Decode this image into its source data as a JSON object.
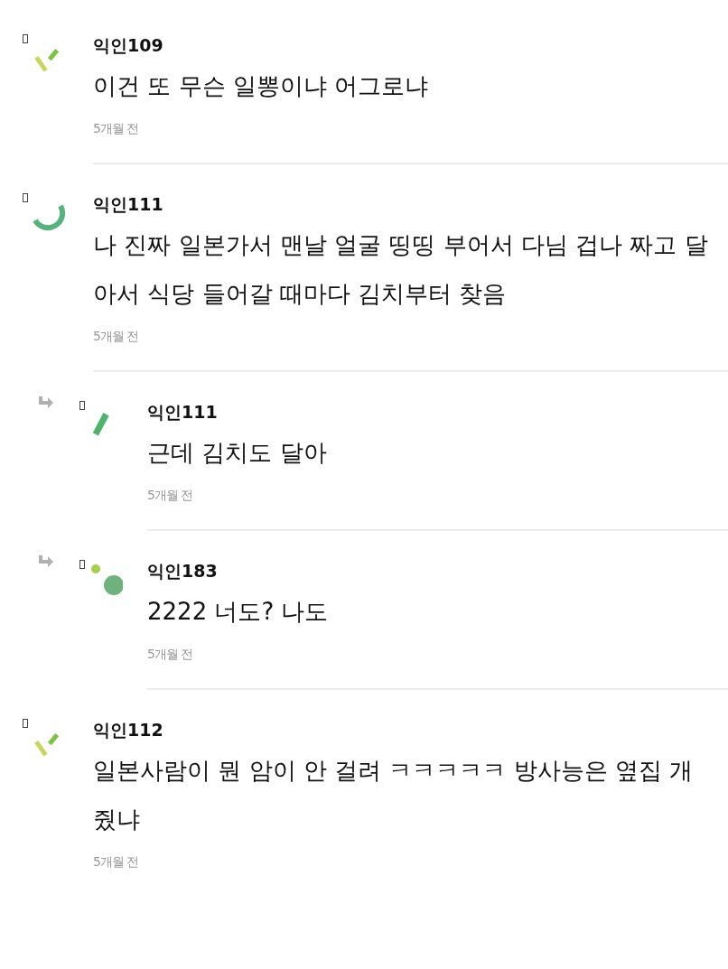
{
  "comments": [
    {
      "author": "익인109",
      "kind": "dashes",
      "text": "이건 또 무슨 일뽕이냐 어그로냐",
      "time": "5개월 전"
    },
    {
      "author": "익인111",
      "kind": "arc",
      "text": "나 진짜 일본가서 맨날 얼굴 띵띵 부어서 다님 겁나 짜고 달아서 식당 들어갈 때마다 김치부터 찾음",
      "time": "5개월 전",
      "children": [
        {
          "author": "익인111",
          "kind": "bar",
          "text": "근데 김치도 달아",
          "time": "5개월 전"
        },
        {
          "author": "익인183",
          "kind": "dots",
          "text": "2222 너도? 나도",
          "time": "5개월 전"
        }
      ]
    },
    {
      "author": "익인112",
      "kind": "dashes",
      "text": "일본사람이 뭔 암이 안 걸려 ㅋㅋㅋㅋㅋ 방사능은 옆집 개 줬냐",
      "time": "5개월 전"
    }
  ]
}
